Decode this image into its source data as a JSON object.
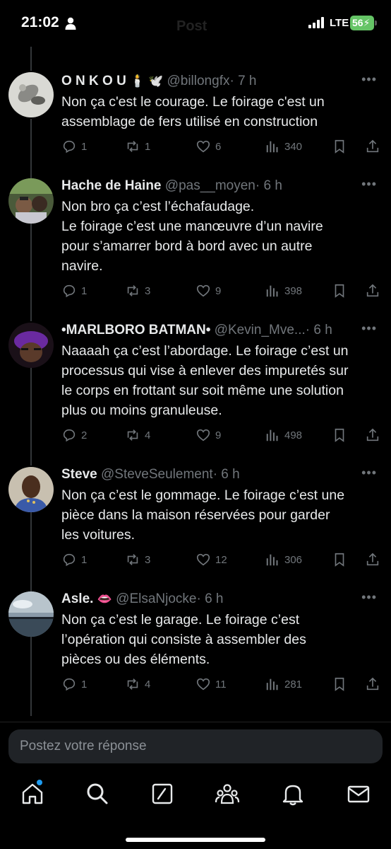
{
  "status_bar": {
    "time": "21:02",
    "network": "LTE",
    "battery": "56",
    "header_ghost": "Post"
  },
  "tweets": [
    {
      "name": "O N K O U",
      "emoji": "🕯️ 🕊️",
      "handle": "@billongfx",
      "time": "· 7 h",
      "lines": [
        "Non ça c'est le courage. Le foirage c'est un",
        "assemblage de fers utilisé en construction"
      ],
      "replies": "1",
      "reposts": "1",
      "likes": "6",
      "views": "340"
    },
    {
      "name": "Hache de Haine",
      "emoji": "",
      "handle": "@pas__moyen",
      "time": "· 6 h",
      "lines": [
        "Non bro ça c’est l’échafaudage.",
        "Le foirage c’est une manœuvre d’un navire",
        "pour s’amarrer bord à bord avec un autre",
        "navire."
      ],
      "replies": "1",
      "reposts": "3",
      "likes": "9",
      "views": "398"
    },
    {
      "name": "•MARLBORO BATMAN•",
      "emoji": "",
      "handle": "@Kevin_Mve...",
      "time": "· 6 h",
      "lines": [
        "Naaaah ça c’est l’abordage. Le foirage c’est un",
        "processus qui vise à enlever des impuretés sur",
        "le corps en frottant sur soit même une solution",
        "plus ou moins granuleuse."
      ],
      "replies": "2",
      "reposts": "4",
      "likes": "9",
      "views": "498"
    },
    {
      "name": "Steve",
      "emoji": "",
      "handle": "@SteveSeulement",
      "time": "· 6 h",
      "lines": [
        "Non ça c’est le gommage. Le foirage c’est une",
        "pièce dans la maison réservées pour garder",
        "les voitures."
      ],
      "replies": "1",
      "reposts": "3",
      "likes": "12",
      "views": "306"
    },
    {
      "name": "Asle.",
      "emoji": "👄",
      "handle": "@ElsaNjocke",
      "time": "· 6 h",
      "lines": [
        "Non ça c’est le garage. Le foirage c’est",
        "l’opération qui consiste à assembler des",
        "pièces ou des éléments."
      ],
      "replies": "1",
      "reposts": "4",
      "likes": "11",
      "views": "281"
    }
  ],
  "reply_box": {
    "placeholder": "Postez votre réponse"
  },
  "nav": {
    "items": [
      "home-icon",
      "search-icon",
      "grok-icon",
      "communities-icon",
      "notifications-icon",
      "messages-icon"
    ],
    "accent": "#1d9bf0"
  },
  "colors": {
    "background": "#000000",
    "text": "#e7e9ea",
    "muted": "#71767b",
    "battery": "#65c466"
  }
}
